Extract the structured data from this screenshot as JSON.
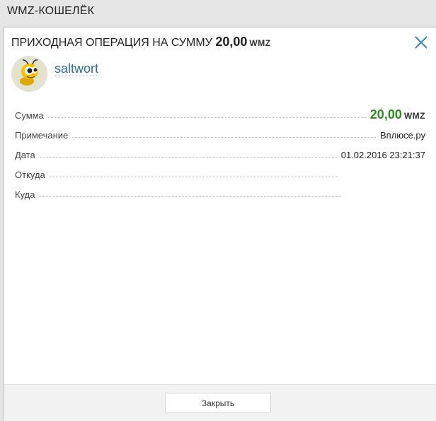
{
  "tab": {
    "title": "WMZ-КОШЕЛЁК"
  },
  "dialog": {
    "header_prefix": "ПРИХОДНАЯ ОПЕРАЦИЯ НА СУММУ",
    "header_amount": "20,00",
    "header_currency": "WMZ",
    "username": "saltwort",
    "close_label": "Закрыть",
    "colors": {
      "accent": "#2a6fa8",
      "sum": "#2e8b1e"
    }
  },
  "details": {
    "sum": {
      "label": "Сумма",
      "amount": "20,00",
      "currency": "WMZ"
    },
    "note": {
      "label": "Примечание",
      "value": "Вплюсе.ру"
    },
    "date": {
      "label": "Дата",
      "value": "01.02.2016 23:21:37"
    },
    "from": {
      "label": "Откуда",
      "value": ""
    },
    "to": {
      "label": "Куда",
      "value": ""
    }
  }
}
